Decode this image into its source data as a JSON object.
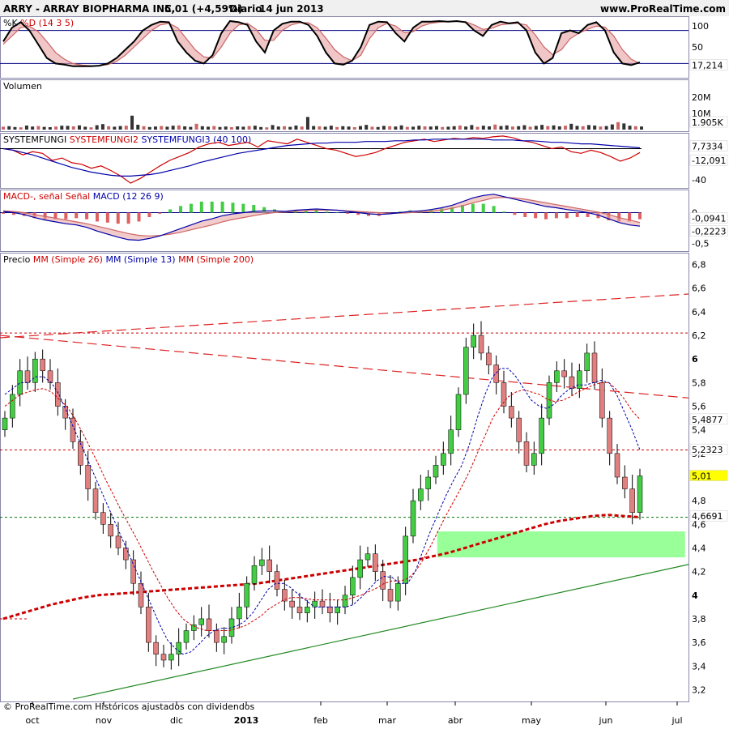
{
  "header": {
    "symbol": "ARRY - ARRAY BIOPHARMA INC.",
    "quote": "5,01 (+4,59%)",
    "period": "Diario",
    "date": "14 jun 2013",
    "site": "www.ProRealTime.com"
  },
  "footer": {
    "copyright": "© ProRealTime.com Históricos ajustados con dividendos"
  },
  "colors": {
    "up_candle": "#44cc44",
    "down_candle": "#e08080",
    "support_zone": "#99ff99",
    "grid": "#000080",
    "ma26": "#cc0000",
    "ma13": "#0000aa",
    "ma200": "#cc0000"
  },
  "x_axis": [
    "oct",
    "nov",
    "dic",
    "2013",
    "feb",
    "mar",
    "abr",
    "may",
    "jun",
    "jul"
  ],
  "chart_data": [
    {
      "id": "stoch",
      "type": "line",
      "title_parts": [
        {
          "text": "%K",
          "color": "#000000"
        },
        {
          "text": " %D",
          "color": "#cc0000"
        },
        {
          "text": " (14 3 5)",
          "color": "#cc0000"
        }
      ],
      "y_ticks": [
        "100",
        "50"
      ],
      "ylim": [
        0,
        100
      ],
      "levels": [
        80,
        20
      ],
      "last_value": "17,214",
      "series": [
        {
          "name": "%K",
          "values": [
            60,
            85,
            95,
            80,
            55,
            30,
            20,
            18,
            15,
            15,
            15,
            16,
            20,
            30,
            45,
            60,
            80,
            90,
            96,
            95,
            60,
            40,
            25,
            20,
            35,
            75,
            97,
            95,
            90,
            60,
            40,
            80,
            92,
            96,
            96,
            90,
            70,
            40,
            20,
            18,
            25,
            50,
            90,
            96,
            95,
            75,
            60,
            85,
            96,
            96,
            97,
            96,
            97,
            95,
            80,
            70,
            90,
            96,
            93,
            95,
            80,
            40,
            20,
            30,
            75,
            80,
            75,
            90,
            95,
            80,
            40,
            20,
            17,
            22
          ]
        },
        {
          "name": "%D",
          "values": [
            55,
            70,
            85,
            88,
            78,
            60,
            40,
            28,
            20,
            17,
            16,
            16,
            18,
            24,
            35,
            50,
            65,
            80,
            90,
            93,
            85,
            65,
            45,
            32,
            30,
            50,
            75,
            90,
            93,
            82,
            62,
            62,
            80,
            90,
            94,
            94,
            85,
            66,
            45,
            32,
            25,
            35,
            65,
            85,
            93,
            88,
            76,
            78,
            88,
            93,
            95,
            96,
            96,
            96,
            90,
            82,
            84,
            90,
            92,
            93,
            90,
            72,
            50,
            36,
            45,
            65,
            75,
            82,
            88,
            86,
            70,
            45,
            28,
            20
          ]
        }
      ]
    },
    {
      "id": "volume",
      "type": "bar",
      "title_parts": [
        {
          "text": "Volumen",
          "color": "#000000"
        }
      ],
      "y_ticks": [
        "20M",
        "10M"
      ],
      "ylim": [
        0,
        30
      ],
      "last_value": "1.905K",
      "values": [
        1.8,
        2.1,
        1.6,
        1.4,
        2.5,
        1.9,
        2.2,
        1.7,
        1.5,
        1.9,
        2.4,
        2.3,
        2.0,
        2.6,
        1.8,
        1.4,
        2.7,
        3.4,
        2.1,
        1.8,
        2.2,
        2.4,
        8.6,
        3.0,
        2.1,
        1.6,
        1.9,
        2.2,
        1.8,
        2.4,
        2.6,
        2.0,
        1.7,
        3.6,
        2.1,
        1.8,
        2.2,
        1.6,
        1.9,
        1.5,
        2.0,
        1.8,
        2.2,
        2.4,
        1.6,
        1.4,
        2.8,
        1.9,
        2.1,
        1.7,
        2.5,
        1.9,
        7.8,
        2.2,
        2.0,
        1.8,
        2.4,
        1.6,
        2.1,
        1.9,
        1.5,
        2.2,
        2.9,
        1.8,
        1.6,
        2.3,
        2.1,
        1.9,
        2.6,
        1.7,
        1.8,
        2.4,
        2.0,
        1.9,
        2.2,
        1.6,
        1.8,
        2.1,
        2.5,
        1.9,
        2.8,
        1.7,
        2.4,
        2.0,
        3.1,
        2.2,
        2.6,
        1.9,
        2.1,
        2.7,
        1.8,
        2.3,
        2.9,
        2.2,
        2.6,
        2.0,
        2.4,
        3.6,
        2.3,
        2.1,
        2.8,
        2.5,
        1.9,
        2.2,
        3.2,
        4.6,
        3.8,
        2.4,
        2.1,
        1.9
      ]
    },
    {
      "id": "systemfungi",
      "type": "line",
      "title_parts": [
        {
          "text": "SYSTEMFUNGI",
          "color": "#000000"
        },
        {
          "text": " SYSTEMFUNGI2",
          "color": "#cc0000"
        },
        {
          "text": " SYSTEMFUNGI3 (40 100)",
          "color": "#0000aa"
        }
      ],
      "y_ticks": [
        "0",
        "-40"
      ],
      "ylim": [
        -48,
        18
      ],
      "levels": [
        0
      ],
      "last_values": [
        "7,7334",
        "-12,091"
      ],
      "series": [
        {
          "name": "SYSTEMFUNGI2",
          "values": [
            0,
            -2,
            -8,
            -4,
            -6,
            -15,
            -12,
            -18,
            -20,
            -25,
            -22,
            -28,
            -35,
            -44,
            -38,
            -30,
            -22,
            -15,
            -10,
            -5,
            2,
            6,
            8,
            4,
            6,
            8,
            2,
            10,
            8,
            6,
            12,
            8,
            4,
            0,
            -2,
            -6,
            -10,
            -8,
            -5,
            0,
            4,
            8,
            10,
            12,
            9,
            11,
            13,
            12,
            14,
            13,
            15,
            16,
            14,
            10,
            8,
            4,
            0,
            2,
            -4,
            -6,
            -2,
            -5,
            -10,
            -16,
            -12,
            -5
          ]
        },
        {
          "name": "SYSTEMFUNGI3",
          "values": [
            0,
            -2,
            -5,
            -8,
            -12,
            -16,
            -20,
            -24,
            -27,
            -30,
            -32,
            -34,
            -35,
            -35,
            -34,
            -33,
            -31,
            -28,
            -25,
            -22,
            -18,
            -15,
            -12,
            -9,
            -6,
            -4,
            -2,
            0,
            2,
            4,
            5,
            6,
            7,
            7,
            8,
            8,
            8,
            9,
            9,
            9,
            10,
            10,
            11,
            11,
            12,
            12,
            12,
            12,
            12,
            12,
            11,
            11,
            11,
            10,
            10,
            9,
            8,
            8,
            7,
            6,
            6,
            5,
            4,
            3,
            2,
            1
          ]
        }
      ]
    },
    {
      "id": "macd",
      "type": "line",
      "title_parts": [
        {
          "text": "MACD-,",
          "color": "#cc0000"
        },
        {
          "text": " señal Señal",
          "color": "#cc0000"
        },
        {
          "text": " MACD (12 26 9)",
          "color": "#0000aa"
        }
      ],
      "y_ticks": [
        "0",
        "-0,5"
      ],
      "ylim": [
        -0.6,
        0.35
      ],
      "levels": [
        0
      ],
      "last_values": [
        "-0,0941",
        "-0,2223"
      ],
      "series": [
        {
          "name": "MACD",
          "values": [
            0.02,
            0.0,
            -0.03,
            -0.08,
            -0.12,
            -0.15,
            -0.18,
            -0.2,
            -0.24,
            -0.3,
            -0.35,
            -0.4,
            -0.44,
            -0.45,
            -0.42,
            -0.38,
            -0.32,
            -0.26,
            -0.2,
            -0.14,
            -0.1,
            -0.05,
            -0.02,
            0.0,
            0.02,
            0.03,
            0.03,
            0.02,
            0.04,
            0.05,
            0.06,
            0.05,
            0.04,
            0.02,
            0.0,
            -0.02,
            -0.03,
            -0.02,
            0.0,
            0.02,
            0.03,
            0.05,
            0.08,
            0.12,
            0.18,
            0.24,
            0.28,
            0.3,
            0.26,
            0.22,
            0.18,
            0.14,
            0.1,
            0.08,
            0.05,
            0.03,
            0.0,
            -0.04,
            -0.1,
            -0.16,
            -0.2,
            -0.22
          ]
        },
        {
          "name": "Señal",
          "values": [
            0.03,
            0.02,
            0.0,
            -0.03,
            -0.06,
            -0.09,
            -0.12,
            -0.15,
            -0.18,
            -0.22,
            -0.26,
            -0.3,
            -0.34,
            -0.37,
            -0.38,
            -0.37,
            -0.35,
            -0.32,
            -0.28,
            -0.24,
            -0.2,
            -0.15,
            -0.11,
            -0.08,
            -0.05,
            -0.02,
            0.0,
            0.01,
            0.02,
            0.03,
            0.04,
            0.04,
            0.04,
            0.03,
            0.02,
            0.01,
            0.0,
            -0.01,
            -0.01,
            0.0,
            0.01,
            0.02,
            0.04,
            0.07,
            0.11,
            0.16,
            0.2,
            0.24,
            0.25,
            0.24,
            0.22,
            0.19,
            0.16,
            0.13,
            0.1,
            0.07,
            0.04,
            0.01,
            -0.03,
            -0.08,
            -0.12,
            -0.16
          ]
        }
      ]
    },
    {
      "id": "price",
      "type": "candlestick",
      "title_parts": [
        {
          "text": "Precio",
          "color": "#000000"
        },
        {
          "text": " MM",
          "color": "#cc0000"
        },
        {
          "text": " (Simple 26)",
          "color": "#cc0000"
        },
        {
          "text": " MM",
          "color": "#0000aa"
        },
        {
          "text": " (Simple 13)",
          "color": "#0000aa"
        },
        {
          "text": " MM",
          "color": "#cc0000"
        },
        {
          "text": " (Simple 200)",
          "color": "#cc0000"
        }
      ],
      "y_ticks": [
        "6,8",
        "6,6",
        "6,4",
        "6,2",
        "6",
        "5,8",
        "5,6",
        "5,4",
        "5,2",
        "5",
        "4,8",
        "4,6",
        "4,4",
        "4,2",
        "4",
        "3,8",
        "3,6",
        "3,4",
        "3,2"
      ],
      "ylim": [
        3.1,
        6.9
      ],
      "value_labels": [
        {
          "text": "5,4877",
          "value": 5.4877,
          "bg": "#ffffff",
          "color": "#cc0000"
        },
        {
          "text": "5,2323",
          "value": 5.2323,
          "bg": "#ffffff",
          "color": "#000080"
        },
        {
          "text": "5,01",
          "value": 5.01,
          "bg": "#ffff00",
          "color": "#000000"
        },
        {
          "text": "4,6691",
          "value": 4.6691,
          "bg": "#ffffff",
          "color": "#cc0000"
        }
      ],
      "h_levels": [
        {
          "value": 6.22,
          "color": "#cc0000"
        },
        {
          "value": 5.23,
          "color": "#cc0000"
        },
        {
          "value": 4.66,
          "color": "#007700"
        },
        {
          "value": 3.8,
          "color": "#cc0000",
          "x_end": 0.04
        }
      ],
      "support_zone": {
        "y0": 4.32,
        "y1": 4.54,
        "x0": 0.635,
        "x1": 0.995
      },
      "close": [
        5.5,
        5.7,
        5.9,
        5.8,
        6.0,
        5.9,
        5.8,
        5.6,
        5.5,
        5.3,
        5.1,
        4.9,
        4.7,
        4.6,
        4.5,
        4.4,
        4.3,
        4.1,
        3.9,
        3.6,
        3.5,
        3.45,
        3.5,
        3.6,
        3.7,
        3.75,
        3.8,
        3.7,
        3.6,
        3.65,
        3.8,
        3.9,
        4.1,
        4.25,
        4.3,
        4.2,
        4.05,
        3.95,
        3.9,
        3.85,
        3.9,
        3.95,
        3.9,
        3.85,
        3.9,
        4.0,
        4.15,
        4.3,
        4.35,
        4.2,
        4.05,
        3.95,
        4.1,
        4.5,
        4.8,
        4.9,
        5.0,
        5.1,
        5.2,
        5.4,
        5.7,
        6.1,
        6.2,
        6.05,
        5.95,
        5.8,
        5.6,
        5.5,
        5.3,
        5.1,
        5.2,
        5.5,
        5.8,
        5.9,
        5.85,
        5.75,
        5.9,
        6.05,
        5.8,
        5.5,
        5.2,
        5.0,
        4.9,
        4.7,
        5.01
      ],
      "open": [
        5.4,
        5.5,
        5.7,
        5.9,
        5.8,
        6.0,
        5.9,
        5.8,
        5.6,
        5.5,
        5.3,
        5.1,
        4.9,
        4.7,
        4.6,
        4.5,
        4.4,
        4.3,
        4.1,
        3.9,
        3.6,
        3.5,
        3.45,
        3.5,
        3.6,
        3.7,
        3.75,
        3.8,
        3.7,
        3.6,
        3.65,
        3.8,
        3.9,
        4.1,
        4.25,
        4.3,
        4.2,
        4.05,
        3.95,
        3.9,
        3.85,
        3.9,
        3.95,
        3.9,
        3.85,
        3.9,
        4.0,
        4.15,
        4.3,
        4.35,
        4.2,
        4.05,
        3.95,
        4.1,
        4.5,
        4.8,
        4.9,
        5.0,
        5.1,
        5.2,
        5.4,
        5.7,
        6.1,
        6.2,
        6.05,
        5.95,
        5.8,
        5.6,
        5.5,
        5.3,
        5.1,
        5.2,
        5.5,
        5.8,
        5.9,
        5.85,
        5.75,
        5.9,
        6.05,
        5.8,
        5.5,
        5.2,
        5.0,
        4.9,
        4.7
      ],
      "ma13": [
        5.7,
        5.75,
        5.8,
        5.8,
        5.85,
        5.85,
        5.8,
        5.7,
        5.55,
        5.4,
        5.25,
        5.1,
        4.95,
        4.8,
        4.65,
        4.5,
        4.35,
        4.2,
        4.05,
        3.9,
        3.75,
        3.62,
        3.55,
        3.5,
        3.52,
        3.58,
        3.65,
        3.7,
        3.72,
        3.72,
        3.74,
        3.78,
        3.85,
        3.95,
        4.05,
        4.1,
        4.1,
        4.06,
        4.0,
        3.95,
        3.9,
        3.9,
        3.9,
        3.9,
        3.9,
        3.92,
        3.98,
        4.05,
        4.12,
        4.16,
        4.15,
        4.1,
        4.1,
        4.2,
        4.38,
        4.55,
        4.7,
        4.85,
        4.98,
        5.1,
        5.28,
        5.5,
        5.7,
        5.85,
        5.92,
        5.92,
        5.85,
        5.75,
        5.65,
        5.6,
        5.58,
        5.62,
        5.7,
        5.75,
        5.78,
        5.78,
        5.8,
        5.82,
        5.8,
        5.7,
        5.55,
        5.4,
        5.23
      ],
      "ma26": [
        5.6,
        5.65,
        5.7,
        5.72,
        5.74,
        5.75,
        5.72,
        5.66,
        5.6,
        5.5,
        5.38,
        5.25,
        5.12,
        4.98,
        4.85,
        4.72,
        4.6,
        4.48,
        4.35,
        4.22,
        4.1,
        3.98,
        3.88,
        3.8,
        3.75,
        3.72,
        3.7,
        3.7,
        3.7,
        3.7,
        3.72,
        3.74,
        3.78,
        3.82,
        3.88,
        3.92,
        3.96,
        3.98,
        3.98,
        3.97,
        3.96,
        3.96,
        3.96,
        3.96,
        3.96,
        3.98,
        4.0,
        4.03,
        4.06,
        4.1,
        4.12,
        4.12,
        4.14,
        4.2,
        4.3,
        4.42,
        4.55,
        4.68,
        4.8,
        4.92,
        5.05,
        5.2,
        5.35,
        5.5,
        5.6,
        5.68,
        5.72,
        5.74,
        5.72,
        5.7,
        5.66,
        5.64,
        5.65,
        5.68,
        5.72,
        5.75,
        5.78,
        5.8,
        5.8,
        5.74,
        5.66,
        5.56,
        5.49
      ],
      "ma200": [
        3.8,
        3.84,
        3.88,
        3.92,
        3.95,
        3.98,
        4.0,
        4.01,
        4.02,
        4.03,
        4.04,
        4.05,
        4.06,
        4.07,
        4.08,
        4.09,
        4.1,
        4.12,
        4.14,
        4.16,
        4.18,
        4.2,
        4.22,
        4.24,
        4.26,
        4.28,
        4.3,
        4.33,
        4.36,
        4.4,
        4.44,
        4.48,
        4.52,
        4.56,
        4.6,
        4.63,
        4.65,
        4.67,
        4.68,
        4.67,
        4.66
      ]
    }
  ]
}
